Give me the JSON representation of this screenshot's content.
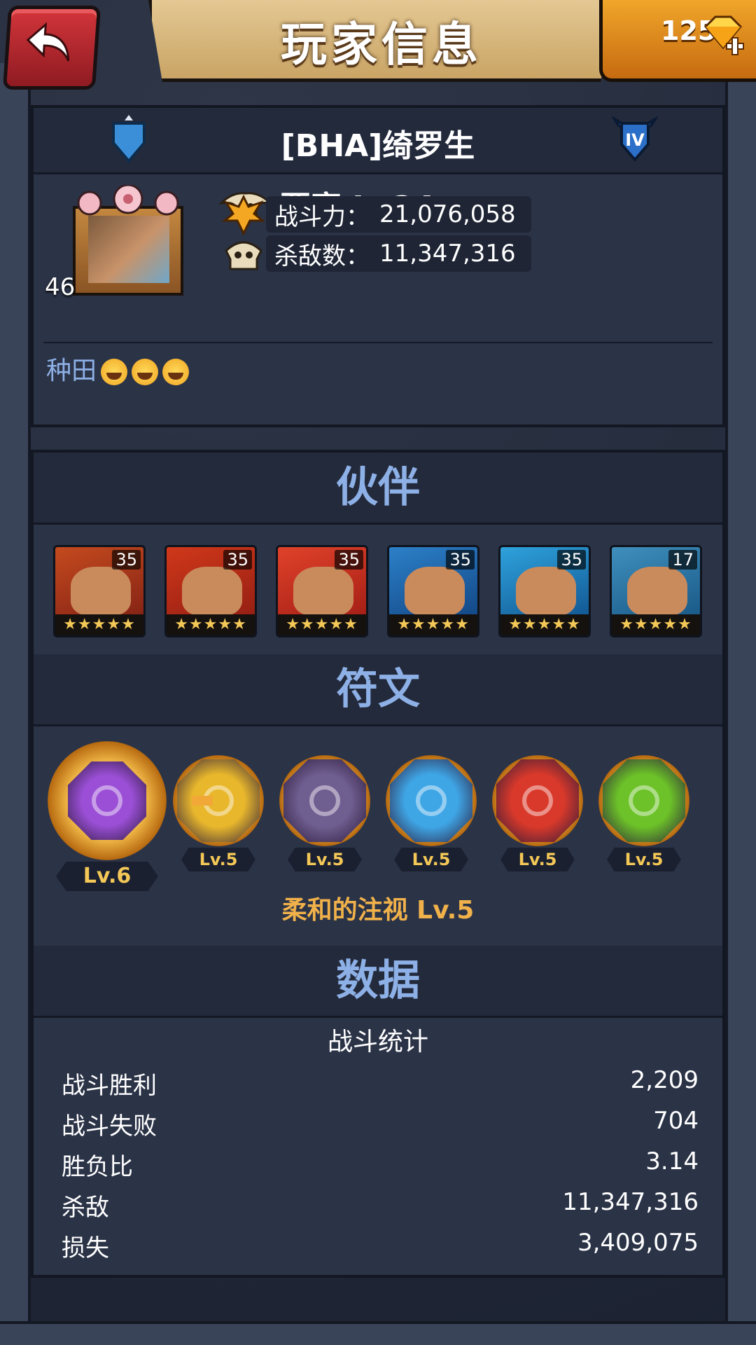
{
  "header": {
    "title": "玩家信息",
    "gems": "125"
  },
  "player": {
    "name": "[BHA]绮罗生",
    "rank_badge": "IV",
    "avatar_level": "46",
    "fortress_label": "要塞 Lv24",
    "power_label": "战斗力：",
    "power_value": "21,076,058",
    "kills_label": "杀敌数：",
    "kills_value": "11,347,316",
    "motto": "种田",
    "motto_emoji_count": 3
  },
  "sections": {
    "partners": "伙伴",
    "runes": "符文",
    "data": "数据"
  },
  "partners": [
    {
      "level": "35",
      "stars": "★★★★★",
      "colors": [
        "#7a1c14",
        "#c44a1e"
      ],
      "icon": "hero-portrait-1"
    },
    {
      "level": "35",
      "stars": "★★★★★",
      "colors": [
        "#8a1a12",
        "#d0381a"
      ],
      "icon": "hero-portrait-2"
    },
    {
      "level": "35",
      "stars": "★★★★★",
      "colors": [
        "#9a1812",
        "#e0422a"
      ],
      "icon": "hero-portrait-3"
    },
    {
      "level": "35",
      "stars": "★★★★★",
      "colors": [
        "#0e3d7a",
        "#2c80c8"
      ],
      "icon": "hero-portrait-4"
    },
    {
      "level": "35",
      "stars": "★★★★★",
      "colors": [
        "#0d4a86",
        "#2ea2dc"
      ],
      "icon": "hero-portrait-5"
    },
    {
      "level": "17",
      "stars": "★★★★★",
      "colors": [
        "#124f7e",
        "#3f8fbc"
      ],
      "icon": "hero-portrait-6"
    }
  ],
  "runes": [
    {
      "level": "Lv.6",
      "color": "#9b4fd6",
      "icon": "crescent-rune-icon"
    },
    {
      "level": "Lv.5",
      "color": "#e8b72c",
      "icon": "star-rune-icon"
    },
    {
      "level": "Lv.5",
      "color": "#6f5e90",
      "icon": "wave-rune-icon"
    },
    {
      "level": "Lv.5",
      "color": "#3fa6e6",
      "icon": "anchor-rune-icon"
    },
    {
      "level": "Lv.5",
      "color": "#d9392a",
      "icon": "cross-rune-icon"
    },
    {
      "level": "Lv.5",
      "color": "#6cc228",
      "icon": "claw-rune-icon"
    }
  ],
  "rune_selected_name": "柔和的注视 Lv.5",
  "stats": {
    "title": "战斗统计",
    "rows": [
      {
        "label": "战斗胜利",
        "value": "2,209"
      },
      {
        "label": "战斗失败",
        "value": "704"
      },
      {
        "label": "胜负比",
        "value": "3.14"
      },
      {
        "label": "杀敌",
        "value": "11,347,316"
      },
      {
        "label": "损失",
        "value": "3,409,075"
      }
    ]
  },
  "colors": {
    "accent_blue": "#8db0e6",
    "accent_gold": "#f0b14a",
    "panel": "#2b3347"
  }
}
